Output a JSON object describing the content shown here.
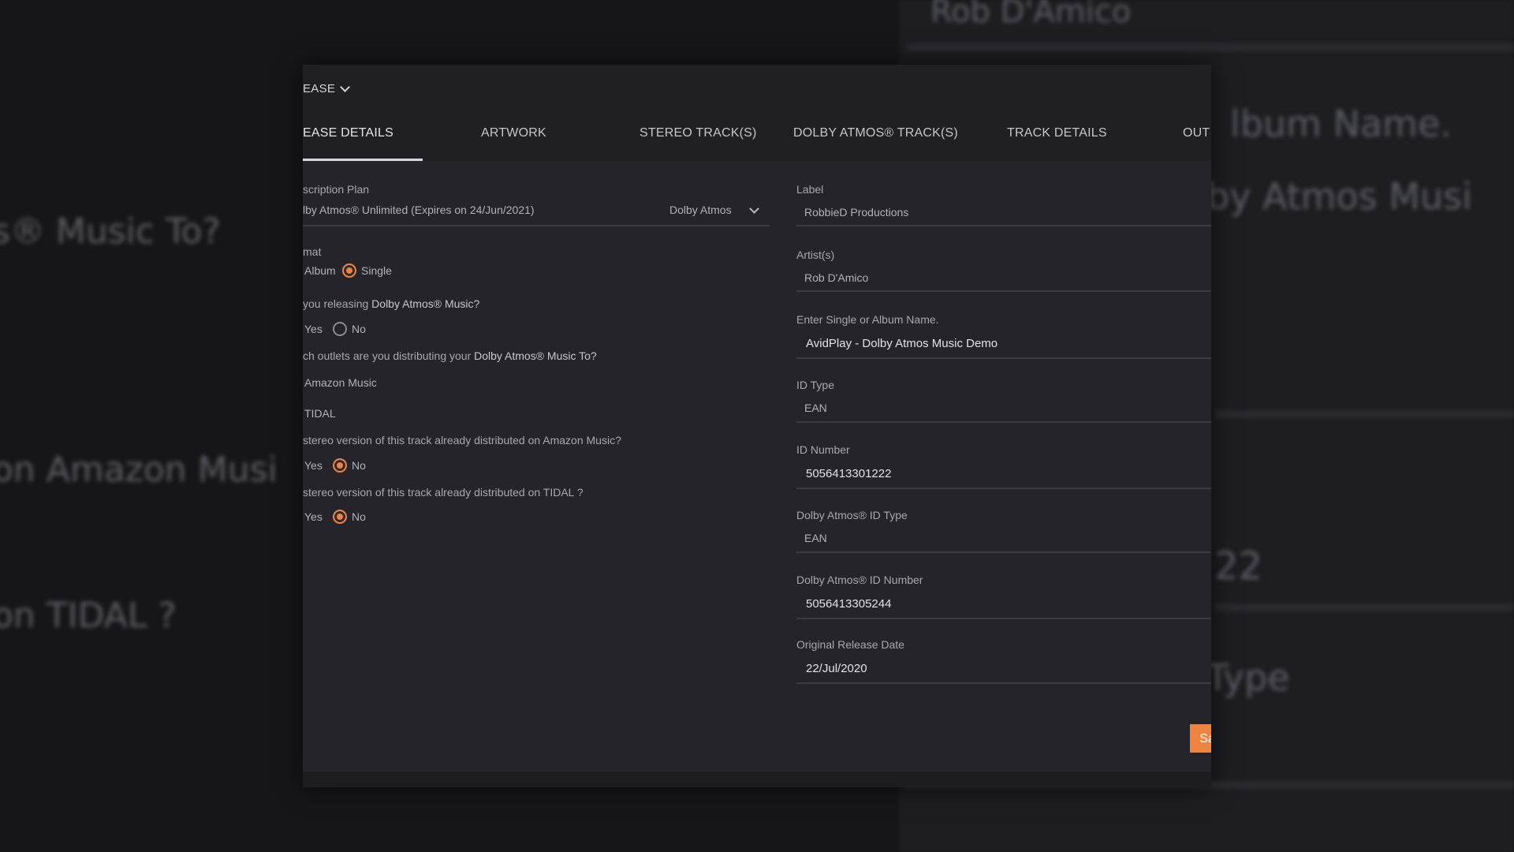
{
  "background": {
    "top_right_text": "Rob D'Amico",
    "right_album_label": "lbum Name.",
    "right_album_value": "by Atmos Musi",
    "right_id_fragment": "22",
    "right_type_fragment": "Type",
    "left_music_to": "s® Music To?",
    "left_amazon": "on Amazon Musi",
    "left_tidal": "on TIDAL ?"
  },
  "header": {
    "release_toggle": "EASE"
  },
  "tabs": [
    {
      "label": "EASE DETAILS"
    },
    {
      "label": "ARTWORK"
    },
    {
      "label": "STEREO TRACK(S)"
    },
    {
      "label": "DOLBY ATMOS® TRACK(S)"
    },
    {
      "label": "TRACK DETAILS"
    },
    {
      "label": "OUT"
    }
  ],
  "left": {
    "subscription_label": "scription Plan",
    "subscription_value": "lby Atmos® Unlimited (Expires on 24/Jun/2021)",
    "subscription_select": "Dolby Atmos",
    "format_label": "mat",
    "format_album": "Album",
    "format_single": "Single",
    "releasing_question_prefix": "you releasing ",
    "releasing_question_highlight": "Dolby Atmos® Music?",
    "yes": "Yes",
    "no": "No",
    "outlets_question_prefix": "ch outlets are you distributing your ",
    "outlets_question_highlight": "Dolby Atmos® Music To?",
    "outlet_amazon": "Amazon Music",
    "outlet_tidal": "TIDAL",
    "amazon_question": "stereo version of this track already distributed on Amazon Music?",
    "tidal_question": "stereo version of this track already distributed on TIDAL ?"
  },
  "right": {
    "label_label": "Label",
    "label_value": "RobbieD Productions",
    "artists_label": "Artist(s)",
    "artists_value": "Rob D'Amico",
    "album_name_label": "Enter Single or Album Name.",
    "album_name_value": "AvidPlay - Dolby Atmos Music Demo",
    "id_type_label": "ID Type",
    "id_type_value": "EAN",
    "id_number_label": "ID Number",
    "id_number_value": "5056413301222",
    "atmos_id_type_label": "Dolby Atmos® ID Type",
    "atmos_id_type_value": "EAN",
    "atmos_id_number_label": "Dolby Atmos® ID Number",
    "atmos_id_number_value": "5056413305244",
    "release_date_label": "Original Release Date",
    "release_date_value": "22/Jul/2020"
  },
  "actions": {
    "save_label": "Sa"
  },
  "colors": {
    "accent": "#f0823f",
    "panel": "#24242a",
    "topbar": "#1f1f24"
  }
}
